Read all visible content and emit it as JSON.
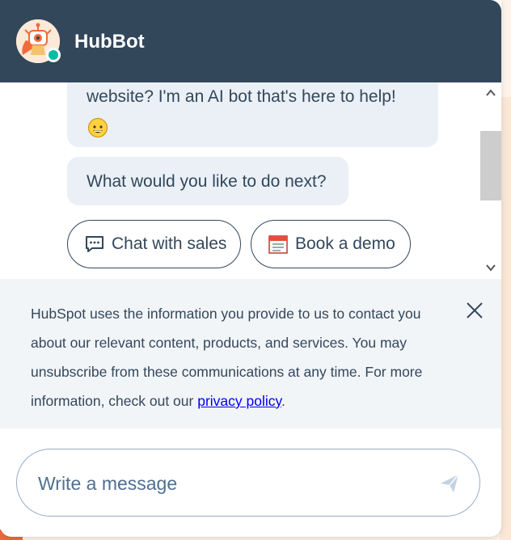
{
  "header": {
    "bot_name": "HubBot",
    "avatar_icon": "robot-avatar-icon",
    "online_color": "#00bda5",
    "background": "#33475b"
  },
  "messages": {
    "bot_message_1": "website? I'm an AI bot that's here to help!",
    "bot_message_1_emoji": "grinning-face-emoji",
    "bot_message_2": "What would you like to do next?"
  },
  "quick_replies": {
    "chat_with_sales": {
      "label": "Chat with sales",
      "icon": "chat-bubble-icon"
    },
    "book_a_demo": {
      "label": "Book a demo",
      "icon": "calendar-icon"
    }
  },
  "notice": {
    "text_before_link": "HubSpot uses the information you provide to us to contact you about our relevant content, products, and services. You may unsubscribe from these communications at any time. For more information, check out our ",
    "link_text": "privacy policy",
    "text_after_link": ".",
    "close_icon": "close-icon"
  },
  "composer": {
    "placeholder": "Write a message",
    "value": "",
    "send_icon": "send-icon"
  },
  "colors": {
    "accent_orange": "#ef6b3b",
    "bubble_bg": "#eaf0f6",
    "text": "#33475b"
  }
}
